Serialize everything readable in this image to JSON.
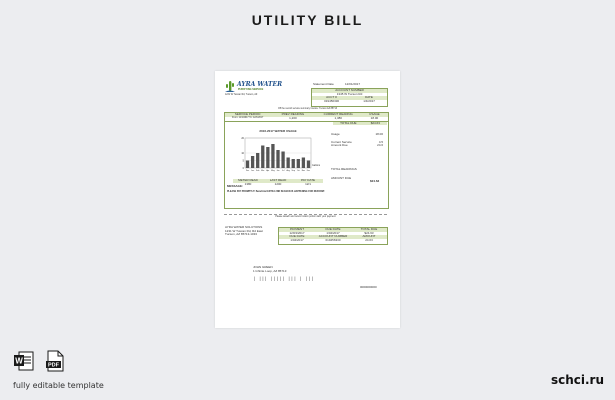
{
  "page_title": "UTILITY BILL",
  "brand_site": "schci.ru",
  "footer_note": "fully editable template",
  "icons": [
    "word-file-icon",
    "pdf-file-icon"
  ],
  "pdf_icon_label": "PDF",
  "document": {
    "company_name_1": "AYRA WATER",
    "company_name_2": "PURIFYING SERVICE",
    "company_addr": "1231 W Tuscan Rd, Tucson, AZ",
    "statement_date_label": "Statement Date",
    "statement_date": "12/01/2017",
    "account_header": "ACCOUNT NUMBER",
    "account_sub": "1345 W Tucson Rd",
    "acct_row": [
      "ACCT #",
      "DATE"
    ],
    "acct_vals": [
      "019456330",
      "1/4/2017"
    ],
    "notice": "Off the record service summary Invoice: Tucson AZ 85713",
    "table_headers": [
      "SERVICE PERIOD",
      "PREV READING",
      "CURRENT READING",
      "USAGE"
    ],
    "table_row": [
      "From: 11/1/2017 To: 12/1/2017",
      "1,200",
      "1,380",
      "18.00"
    ],
    "total_label": "TOTAL DUE",
    "total_value": "$24.63",
    "chart_title": "2016-2017 WATER USAGE",
    "side_labels": [
      "Usage",
      "Current Service",
      "Amount Due"
    ],
    "side_values": [
      "18.00",
      "4.5",
      "24.6"
    ],
    "reading_label": "TOTAL READINGS",
    "bottom_headers": [
      "METER READ",
      "LAST READ",
      "PAY DATE"
    ],
    "bottom_vals": [
      "1380",
      "1200",
      "12/1"
    ],
    "amount_due_label": "AMOUNT DUE",
    "amount_due": "$24.63",
    "message_label": "MESSAGE:",
    "message_text": "PLEASE PAY PROMPTLY! Beneficial EXTRA 2ND SEASON IS HAPPENING FOR REFORM!",
    "tear_text": "Please detach and return bottom portion with your payment",
    "remit_lines": [
      "AYRA WATER SOLUTIONS",
      "1231 W Tuscan Rd, Rd East",
      "Tucson, AZ 85713-1033"
    ],
    "stub_headers": [
      "PAYMENT",
      "DUE DATE",
      "TOTAL DUE"
    ],
    "stub_vals": [
      "12/03/2017",
      "1/04/2017",
      "$24.63"
    ],
    "stub_headers2": [
      "DUE DATE",
      "ACCOUNT NUMBER",
      "AMOUNT"
    ],
    "stub_vals2": [
      "1/04/2017",
      "019456330",
      "24.63"
    ],
    "customer_lines": [
      "JOHN GREEN",
      "1 Infinite Loop, AZ 85713"
    ],
    "barcode_text": "| ||| ||||| ||| | |||",
    "footer_code": "0000000000"
  },
  "chart_data": {
    "type": "bar",
    "title": "2016-2017 WATER USAGE",
    "categories": [
      "Dec",
      "Jan",
      "Feb",
      "Mar",
      "Apr",
      "May",
      "Jun",
      "Jul",
      "Aug",
      "Sep",
      "Oct",
      "Nov",
      "Dec"
    ],
    "values": [
      5,
      8,
      10,
      15,
      14,
      16,
      12,
      11,
      7,
      6,
      6,
      7,
      5
    ],
    "ylim": [
      0,
      20
    ],
    "yticks": [
      "20",
      "10",
      "5",
      "0"
    ],
    "legend": "Gallons",
    "grid": true,
    "color": "#555555"
  }
}
